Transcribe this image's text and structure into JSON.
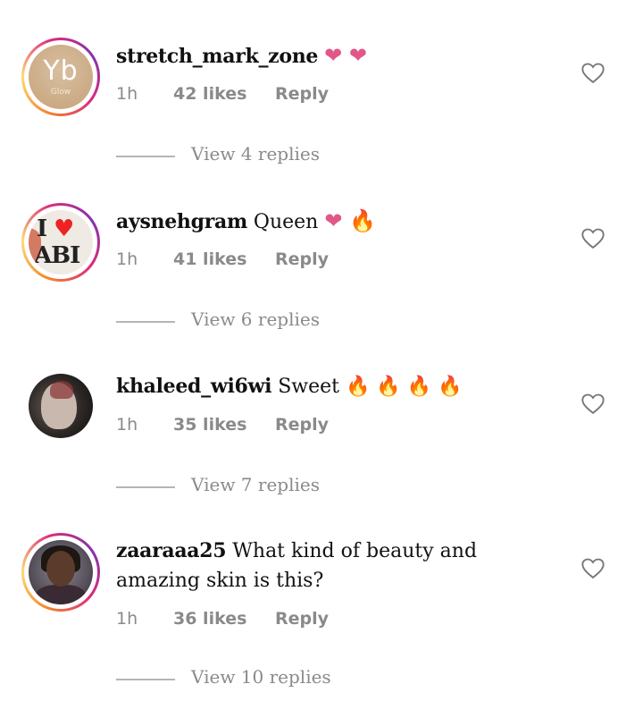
{
  "comments": [
    {
      "username": "stretch_mark_zone",
      "text": "",
      "emojis": "❤ ❤",
      "time": "1h",
      "likes": "42 likes",
      "reply": "Reply",
      "view_replies": "View 4 replies",
      "avatar": {
        "line1": "Yb",
        "line2": "Glow"
      }
    },
    {
      "username": "aysnehgram",
      "text": "Queen",
      "emojis": "❤ 🔥",
      "time": "1h",
      "likes": "41 likes",
      "reply": "Reply",
      "view_replies": "View 6 replies",
      "avatar": {
        "line1": "I",
        "line2": "ABI"
      }
    },
    {
      "username": "khaleed_wi6wi",
      "text": "Sweet",
      "emojis": "🔥 🔥 🔥 🔥",
      "time": "1h",
      "likes": "35 likes",
      "reply": "Reply",
      "view_replies": "View 7 replies"
    },
    {
      "username": "zaaraaa25",
      "text": "What kind of beauty and amazing skin is this?",
      "emojis": "",
      "time": "1h",
      "likes": "36 likes",
      "reply": "Reply",
      "view_replies": "View 10 replies"
    }
  ],
  "icons": {
    "like": "heart-outline-icon"
  },
  "colors": {
    "heart_emoji": "#e3568a",
    "fire_emoji": "#f27a1a",
    "meta_text": "#8a8a8a"
  }
}
